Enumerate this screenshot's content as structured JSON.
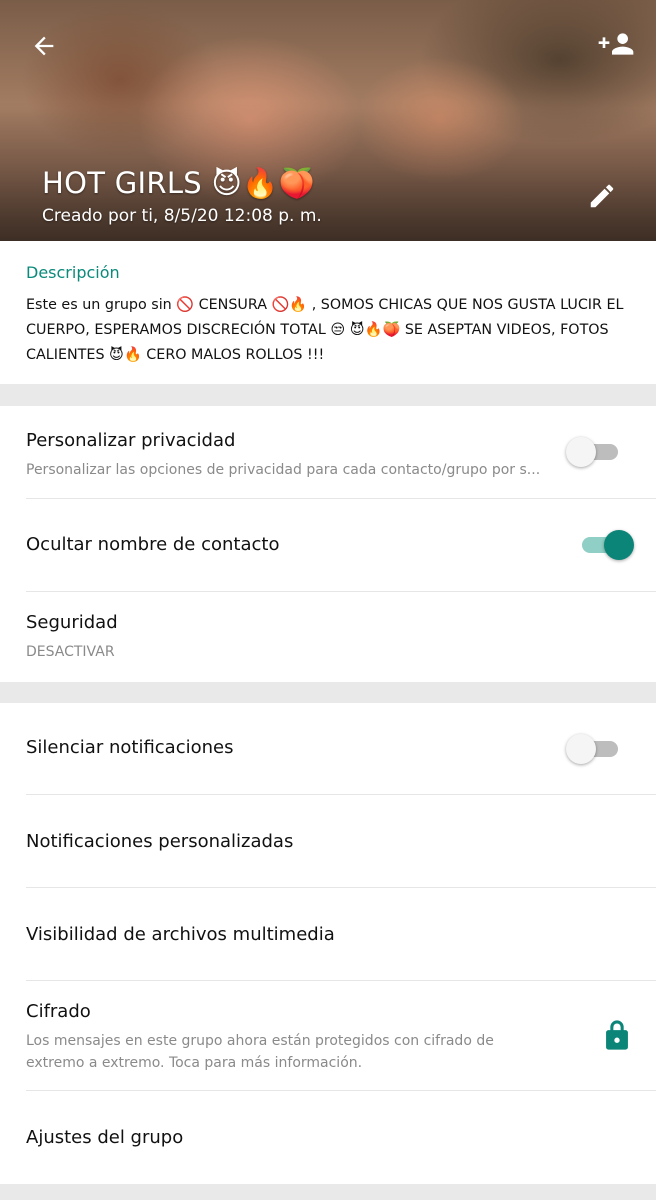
{
  "header": {
    "title": "HOT GIRLS 😈🔥🍑",
    "created": "Creado por ti, 8/5/20 12:08 p. m.",
    "icons": {
      "back": "arrow-back-icon",
      "add": "add-participant-icon",
      "edit": "pencil-icon"
    }
  },
  "description": {
    "label": "Descripción",
    "text": "Este es un grupo sin 🚫 CENSURA 🚫🔥 , SOMOS CHICAS QUE NOS GUSTA LUCIR EL CUERPO, ESPERAMOS DISCRECIÓN TOTAL 😒 😈🔥🍑 SE ASEPTAN VIDEOS, FOTOS CALIENTES 😈🔥 CERO MALOS ROLLOS !!!"
  },
  "privacy": {
    "custom_privacy": {
      "title": "Personalizar privacidad",
      "subtitle": "Personalizar las opciones de privacidad para cada contacto/grupo por s...",
      "enabled": false
    },
    "hide_contact_name": {
      "title": "Ocultar nombre de contacto",
      "enabled": true
    },
    "security": {
      "title": "Seguridad",
      "subtitle": "DESACTIVAR"
    }
  },
  "settings": {
    "mute": {
      "title": "Silenciar notificaciones",
      "enabled": false
    },
    "custom_notifications": {
      "title": "Notificaciones personalizadas"
    },
    "media_visibility": {
      "title": "Visibilidad de archivos multimedia"
    },
    "encryption": {
      "title": "Cifrado",
      "subtitle_line1": "Los mensajes en este grupo ahora están protegidos con cifrado de",
      "subtitle_line2": "extremo a extremo. Toca para más información.",
      "icon": "lock-icon"
    },
    "group_settings": {
      "title": "Ajustes del grupo"
    }
  },
  "colors": {
    "accent": "#0b8577",
    "accent_track": "#8fcfc5",
    "description_label": "#0a8a7a",
    "divider": "#e9e9e9"
  }
}
